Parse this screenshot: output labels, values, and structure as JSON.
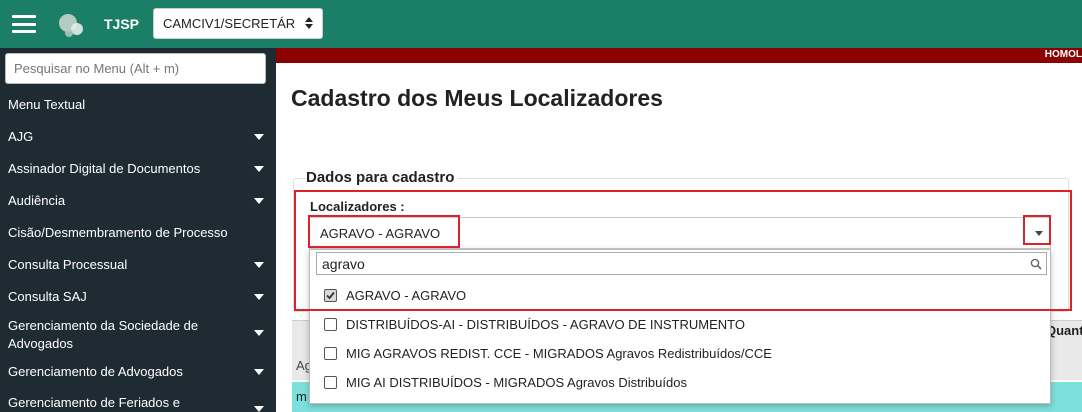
{
  "header": {
    "brand": "TJSP",
    "unit_select_value": "CAMCIV1/SECRETÁR",
    "environment_label": "HOMOL",
    "colors": {
      "topbar": "#1a7f66",
      "env_strip": "#8b0000",
      "sidebar": "#1f2b33",
      "highlight": "#d9232a",
      "row_highlight": "#7ee0dd"
    }
  },
  "sidebar": {
    "search_placeholder": "Pesquisar no Menu (Alt + m)",
    "items": [
      {
        "label": "Menu Textual",
        "has_caret": false
      },
      {
        "label": "AJG",
        "has_caret": true
      },
      {
        "label": "Assinador Digital de Documentos",
        "has_caret": true
      },
      {
        "label": "Audiência",
        "has_caret": true
      },
      {
        "label": "Cisão/Desmembramento de Processo",
        "has_caret": false
      },
      {
        "label": "Consulta Processual",
        "has_caret": true
      },
      {
        "label": "Consulta SAJ",
        "has_caret": true
      },
      {
        "label": "Gerenciamento da Sociedade de Advogados",
        "has_caret": true
      },
      {
        "label": "Gerenciamento de Advogados",
        "has_caret": true
      },
      {
        "label": "Gerenciamento de Feriados e",
        "has_caret": true
      }
    ]
  },
  "main": {
    "title": "Cadastro dos Meus Localizadores",
    "section_legend": "Dados para cadastro",
    "field_label": "Localizadores :",
    "selected_value": "AGRAVO - AGRAVO",
    "dropdown": {
      "search_value": "agravo",
      "options": [
        {
          "label": "AGRAVO - AGRAVO",
          "checked": true
        },
        {
          "label": "DISTRIBUÍDOS-AI - DISTRIBUÍDOS - AGRAVO DE INSTRUMENTO",
          "checked": false
        },
        {
          "label": "MIG AGRAVOS REDIST. CCE - MIGRADOS Agravos Redistribuídos/CCE",
          "checked": false
        },
        {
          "label": "MIG AI DISTRIBUÍDOS - MIGRADOS Agravos Distribuídos",
          "checked": false
        }
      ]
    },
    "table": {
      "header_partial_qty": "Quant",
      "header_partial_ag": "Ag",
      "row_partial": "m"
    }
  }
}
